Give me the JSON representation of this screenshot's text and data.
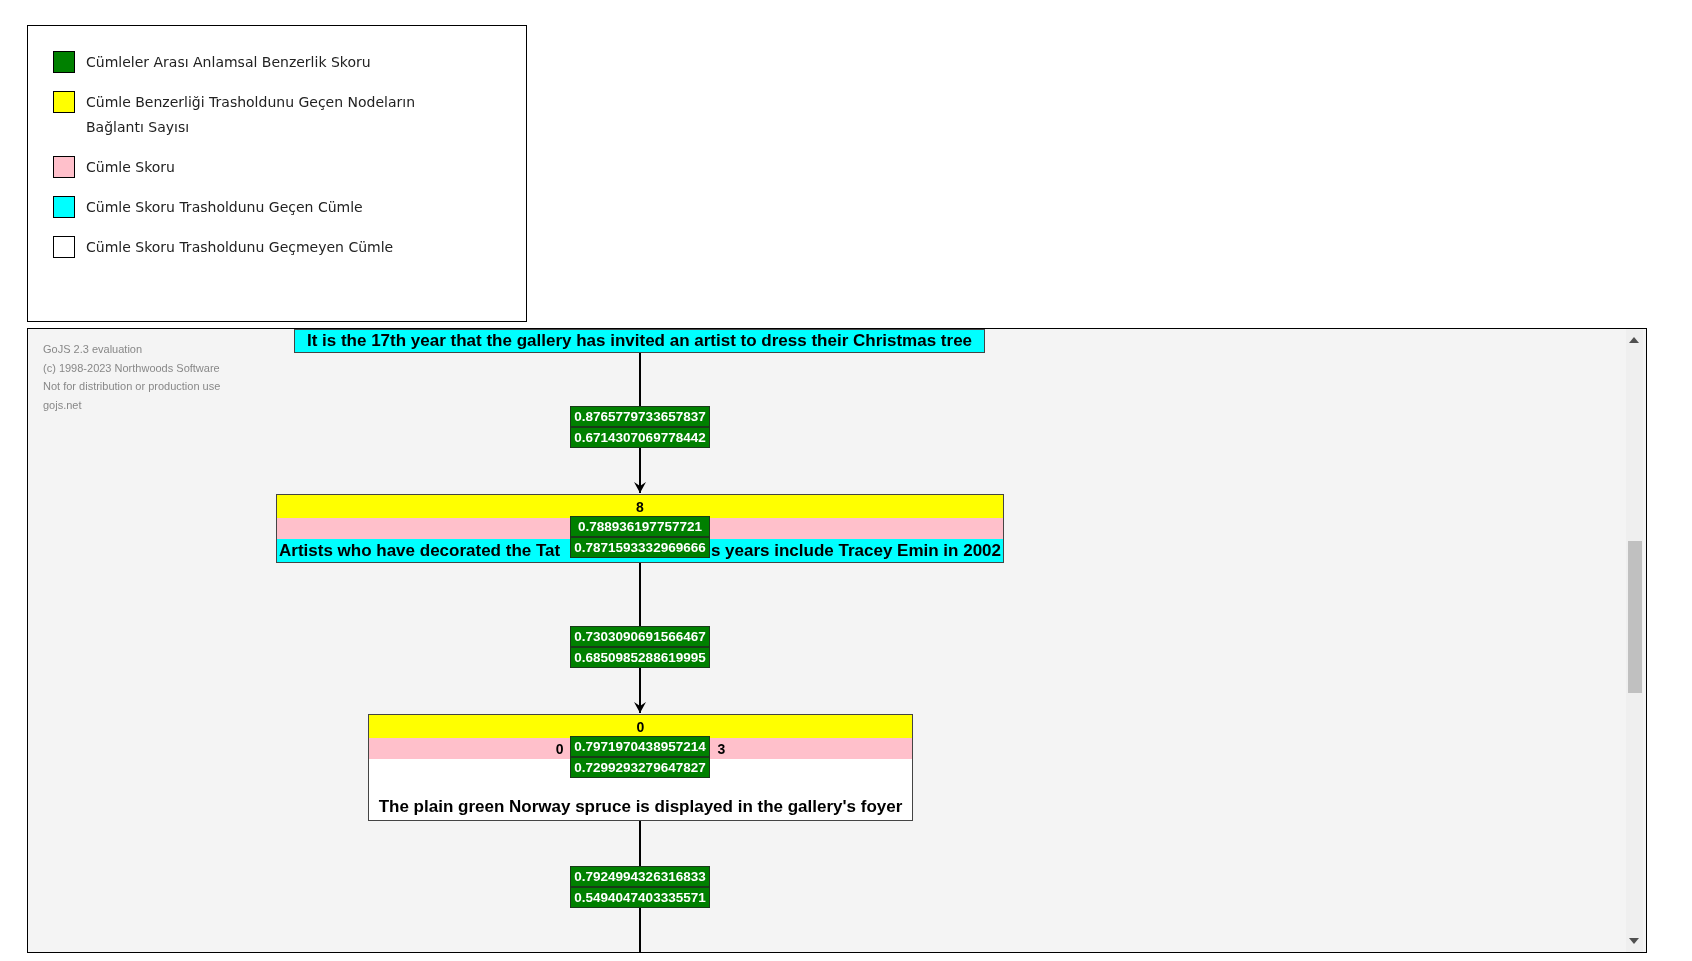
{
  "legend": {
    "items": [
      {
        "label": "Cümleler Arası Anlamsal Benzerlik Skoru",
        "color": "#008000"
      },
      {
        "label": "Cümle Benzerliği Trasholdunu Geçen Nodeların Bağlantı Sayısı",
        "color": "#ffff00"
      },
      {
        "label": "Cümle Skoru",
        "color": "#ffc0cb"
      },
      {
        "label": "Cümle Skoru Trasholdunu Geçen Cümle",
        "color": "#00ffff"
      },
      {
        "label": "Cümle Skoru Trasholdunu Geçmeyen Cümle",
        "color": "#ffffff"
      }
    ]
  },
  "diagram": {
    "watermark": [
      "GoJS 2.3 evaluation",
      "(c) 1998-2023 Northwoods Software",
      "Not for distribution or production use",
      "gojs.net"
    ],
    "nodes": [
      {
        "kind": "clipped",
        "passed": true,
        "sentence_parts": [
          "It is the 17th year that the gallery has invited an artist to dress their Christmas tree"
        ]
      },
      {
        "kind": "full",
        "passed": true,
        "link_count": "8",
        "sentence_parts": [
          "Artists who have decorated the Tat",
          "s years include Tracey Emin in 2002"
        ]
      },
      {
        "kind": "full",
        "passed": false,
        "link_count": "0",
        "score_parts": [
          "0",
          "3"
        ],
        "sentence_parts": [
          "The plain green Norway spruce is displayed in the gallery's foyer"
        ]
      }
    ],
    "similarity_labels": [
      {
        "values": [
          "0.8765779733657837",
          "0.6714307069778442"
        ]
      },
      {
        "values": [
          "0.788936197757721",
          "0.7871593332969666"
        ]
      },
      {
        "values": [
          "0.7303090691566467",
          "0.6850985288619995"
        ]
      },
      {
        "values": [
          "0.7971970438957214",
          "0.7299293279647827"
        ]
      },
      {
        "values": [
          "0.7924994326316833",
          "0.5494047403335571"
        ]
      }
    ]
  }
}
